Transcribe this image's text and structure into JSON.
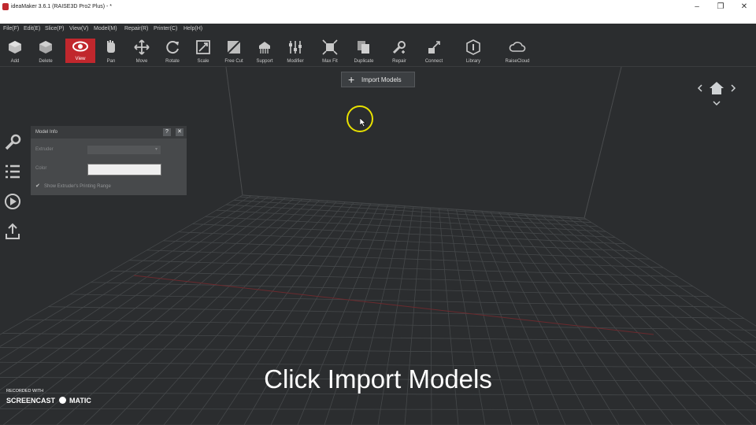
{
  "window": {
    "title": "ideaMaker 3.6.1 (RAISE3D Pro2 Plus) - *",
    "brand_color": "#c1272d"
  },
  "menu": [
    "File(F)",
    "Edit(E)",
    "Slice(P)",
    "View(V)",
    "Model(M)",
    "Repair(R)",
    "Printer(C)",
    "Help(H)"
  ],
  "toolbar": {
    "tools": [
      {
        "label": "Add",
        "icon": "add-cube-icon"
      },
      {
        "label": "Delete",
        "icon": "delete-cube-icon"
      },
      {
        "label": "View",
        "icon": "eye-icon"
      },
      {
        "label": "Pan",
        "icon": "hand-icon"
      },
      {
        "label": "Move",
        "icon": "move-arrows-icon"
      },
      {
        "label": "Rotate",
        "icon": "rotate-icon"
      },
      {
        "label": "Scale",
        "icon": "scale-icon"
      },
      {
        "label": "Free Cut",
        "icon": "cut-icon"
      },
      {
        "label": "Support",
        "icon": "support-icon"
      },
      {
        "label": "Modifier",
        "icon": "sliders-icon"
      },
      {
        "label": "Max Fit",
        "icon": "max-fit-icon"
      },
      {
        "label": "Duplicate",
        "icon": "duplicate-icon"
      },
      {
        "label": "Repair",
        "icon": "wrench-icon"
      },
      {
        "label": "Connect",
        "icon": "connect-icon"
      },
      {
        "label": "Library",
        "icon": "library-icon"
      },
      {
        "label": "RaiseCloud",
        "icon": "cloud-icon"
      }
    ],
    "active": "View"
  },
  "import_button": {
    "label": "Import Models"
  },
  "model_info": {
    "title": "Model Info",
    "help": "?",
    "close": "✕",
    "extruder_label": "Extruder",
    "color_label": "Color",
    "checkbox_label": "Show Extruder's Printing Range",
    "color_value": "#ffffff"
  },
  "caption": "Click Import Models",
  "watermark": {
    "line1": "RECORDED WITH",
    "line2": "SCREENCAST",
    "line3": "MATIC"
  }
}
